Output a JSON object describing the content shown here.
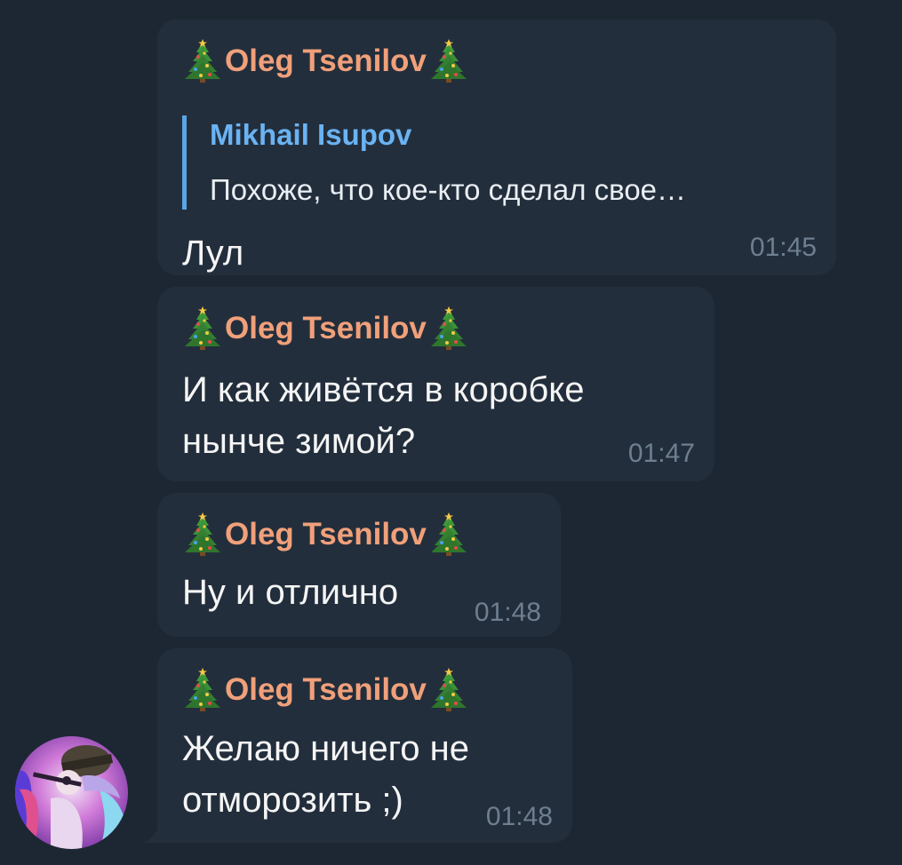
{
  "messages": [
    {
      "sender": "Oleg Tsenilov",
      "reply": {
        "name": "Mikhail Isupov",
        "text": "Похоже, что кое-кто сделал свое…"
      },
      "lines": [
        "Лул"
      ],
      "time": "01:45"
    },
    {
      "sender": "Oleg Tsenilov",
      "lines": [
        "И как живётся в коробке",
        "нынче зимой?"
      ],
      "time": "01:47"
    },
    {
      "sender": "Oleg Tsenilov",
      "lines": [
        "Ну и отлично"
      ],
      "time": "01:48"
    },
    {
      "sender": "Oleg Tsenilov",
      "lines": [
        "Желаю ничего не",
        "отморозить ;)"
      ],
      "time": "01:48"
    }
  ],
  "icons": {
    "sender_decoration": "christmas-tree-icon",
    "avatar": "user-avatar"
  },
  "colors": {
    "background": "#1d2733",
    "bubble": "#232e3c",
    "sender_name": "#f0a07a",
    "reply_name": "#6ab3f3",
    "reply_bar": "#5aa5e5",
    "text": "#f5f5f5",
    "time": "#6d7f90"
  }
}
